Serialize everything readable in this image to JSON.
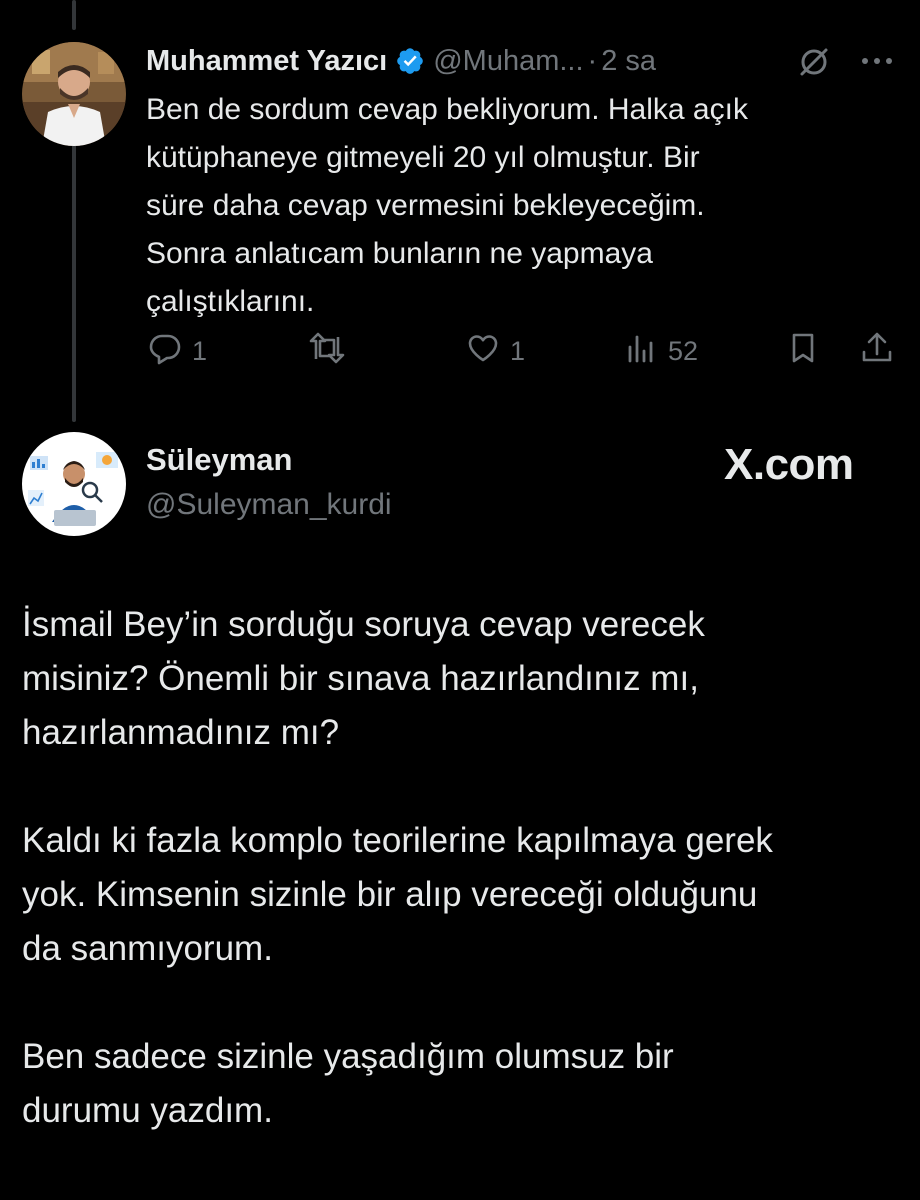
{
  "tweet1": {
    "author_name": "Muhammet Yazıcı",
    "handle": "@Muham...",
    "dot": "·",
    "time": "2 sa",
    "text_lines": [
      "Ben de sordum cevap bekliyorum. Halka açık",
      "kütüphaneye gitmeyeli 20 yıl olmuştur. Bir",
      "süre daha cevap vermesini bekleyeceğim.",
      "Sonra anlatıcam bunların ne yapmaya",
      "çalıştıklarını."
    ],
    "actions": {
      "reply_count": "1",
      "retweet_count": "",
      "like_count": "1",
      "views_count": "52"
    },
    "icons": [
      "verified-badge-icon",
      "grok-icon",
      "more-icon",
      "reply-icon",
      "retweet-icon",
      "like-icon",
      "views-icon",
      "bookmark-icon",
      "share-icon"
    ]
  },
  "tweet2": {
    "author_name": "Süleyman",
    "handle": "@Suleyman_kurdi",
    "source_label": "X.com",
    "paragraphs": [
      [
        "İsmail Bey’in sorduğu soruya cevap verecek",
        "misiniz? Önemli bir sınava hazırlandınız mı,",
        "hazırlanmadınız mı?"
      ],
      [
        "Kaldı ki fazla komplo teorilerine kapılmaya gerek",
        "yok. Kimsenin sizinle bir alıp vereceği olduğunu",
        "da sanmıyorum."
      ],
      [
        "Ben sadece sizinle yaşadığım olumsuz bir",
        "durumu yazdım."
      ]
    ]
  },
  "colors": {
    "background": "#000000",
    "text_primary": "#e7e9ea",
    "text_secondary": "#71767b",
    "verified_blue": "#1d9bf0",
    "thread_line": "#333639"
  }
}
